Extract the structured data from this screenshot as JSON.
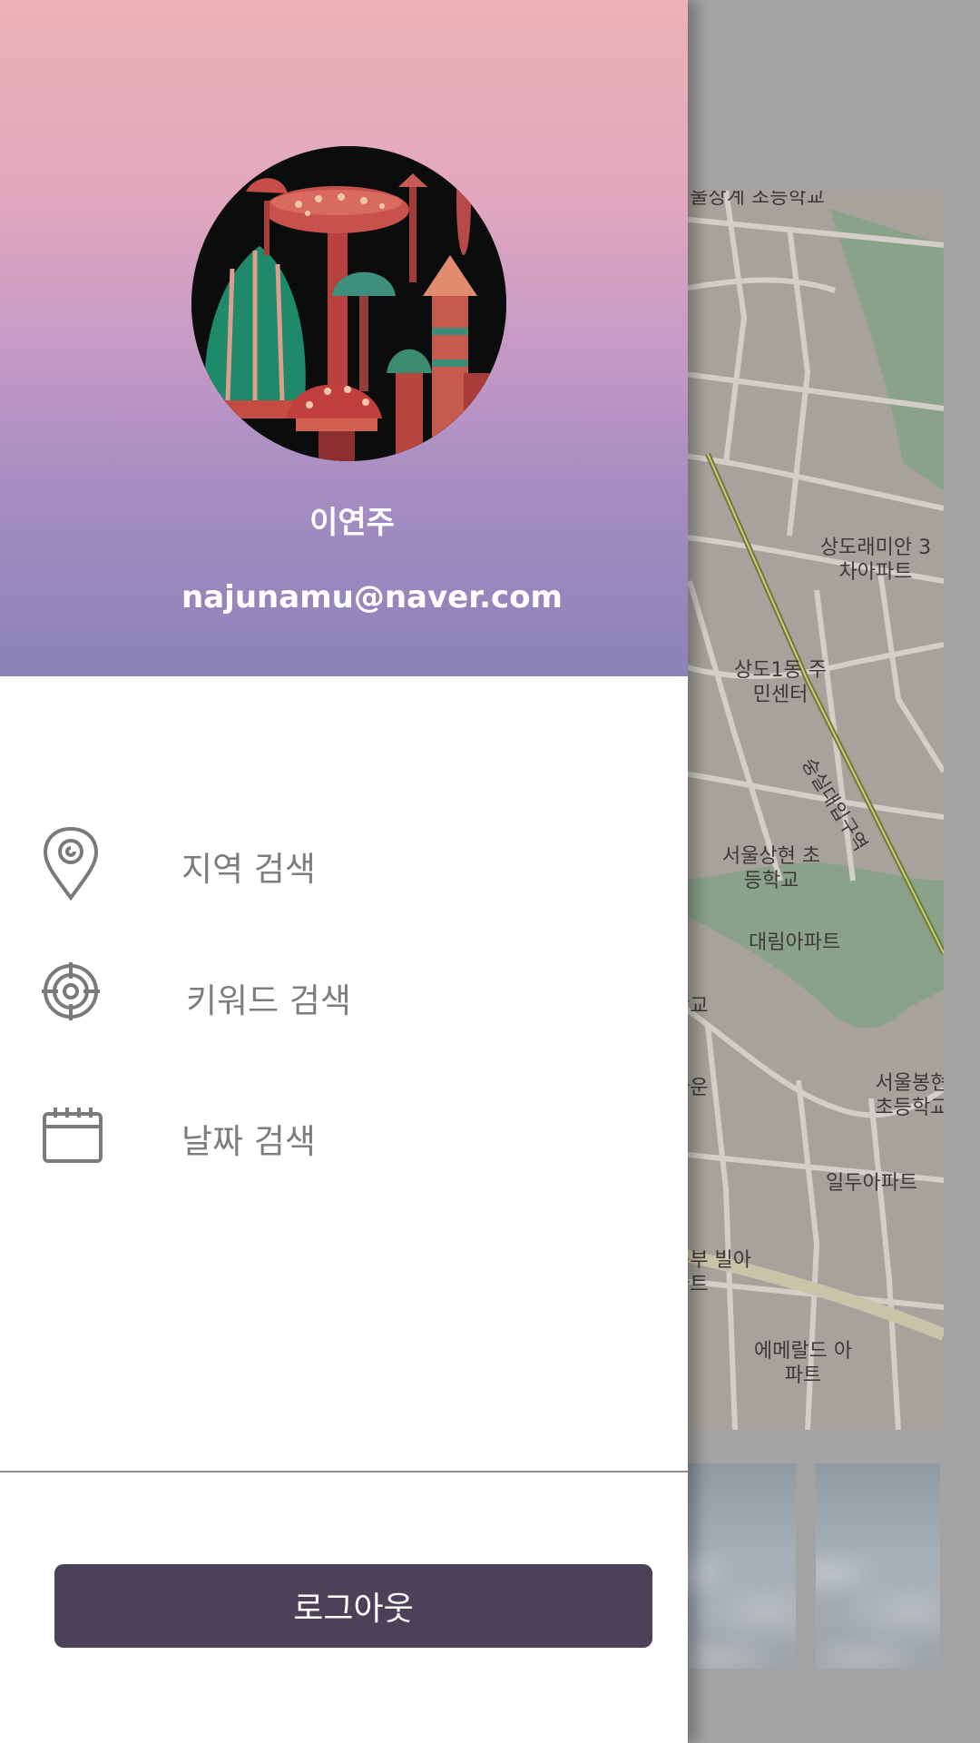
{
  "profile": {
    "name": "이연주",
    "email": "najunamu@naver.com"
  },
  "menu": [
    {
      "label": "지역 검색",
      "icon": "location-pin-icon"
    },
    {
      "label": "키워드 검색",
      "icon": "target-icon"
    },
    {
      "label": "날짜 검색",
      "icon": "calendar-icon"
    }
  ],
  "logout": {
    "label": "로그아웃"
  },
  "background_map": {
    "labels": [
      "서울상계 초등학교",
      "상도래미안 3차아파트",
      "상도1동 주민센터",
      "숭실대입구역",
      "서울상현 초등학교",
      "대림아파트",
      "서울봉현 초등학교",
      "일두아파트",
      "에메랄드 아파트",
      "타운",
      "학교",
      "동부 빌아파트"
    ]
  },
  "colors": {
    "header_top": "#ecb2b6",
    "header_bottom": "#8a83b8",
    "logout_button": "#4a4258",
    "menu_text": "#7d7d7d",
    "scrim": "#a3a3a3"
  }
}
